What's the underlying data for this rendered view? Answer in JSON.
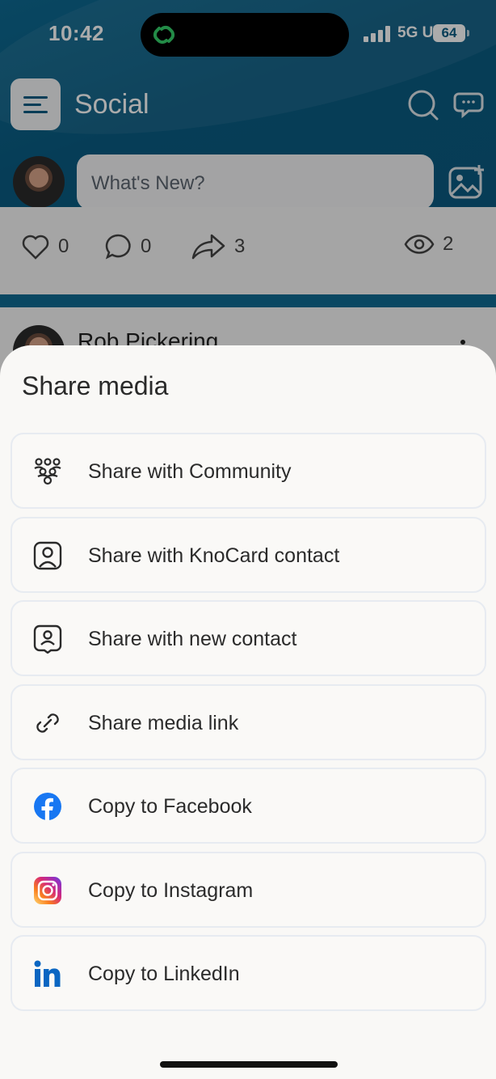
{
  "status": {
    "time": "10:42",
    "network": "5G UW",
    "battery": "64"
  },
  "header": {
    "title": "Social"
  },
  "compose": {
    "placeholder": "What's New?"
  },
  "post_stats": {
    "likes": "0",
    "comments": "0",
    "shares": "3",
    "views": "2"
  },
  "post": {
    "author": "Rob Pickering"
  },
  "sheet": {
    "title": "Share media",
    "options": [
      {
        "label": "Share with Community",
        "icon": "community-icon"
      },
      {
        "label": "Share with KnoCard contact",
        "icon": "contact-card-icon"
      },
      {
        "label": "Share with new contact",
        "icon": "new-contact-icon"
      },
      {
        "label": "Share media link",
        "icon": "link-icon"
      },
      {
        "label": "Copy to Facebook",
        "icon": "facebook-icon"
      },
      {
        "label": "Copy to Instagram",
        "icon": "instagram-icon"
      },
      {
        "label": "Copy to LinkedIn",
        "icon": "linkedin-icon"
      }
    ]
  },
  "colors": {
    "header": "#0a5c82",
    "facebook": "#1877f2",
    "linkedin": "#0a66c2",
    "island_link": "#35d06a"
  }
}
